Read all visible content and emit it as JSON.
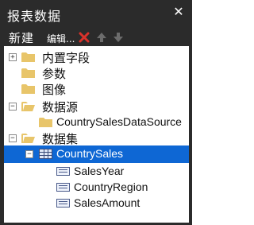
{
  "window": {
    "title": "报表数据"
  },
  "toolbar": {
    "new_label": "新建",
    "edit_label": "编辑..."
  },
  "tree": {
    "builtin_fields": "内置字段",
    "parameters": "参数",
    "images": "图像",
    "data_sources": "数据源",
    "data_source_item": "CountrySalesDataSource",
    "datasets": "数据集",
    "dataset_item": "CountrySales",
    "fields": [
      "SalesYear",
      "CountryRegion",
      "SalesAmount"
    ]
  },
  "colors": {
    "panel_bg": "#2b2b2b",
    "selection": "#0e67d4",
    "folder": "#e8c56a",
    "delete": "#d9322b"
  },
  "icons": {
    "close": "close-icon",
    "delete": "delete-icon",
    "move_up": "arrow-up-icon",
    "move_down": "arrow-down-icon",
    "folder": "folder-icon",
    "table": "table-icon",
    "field": "field-icon"
  }
}
